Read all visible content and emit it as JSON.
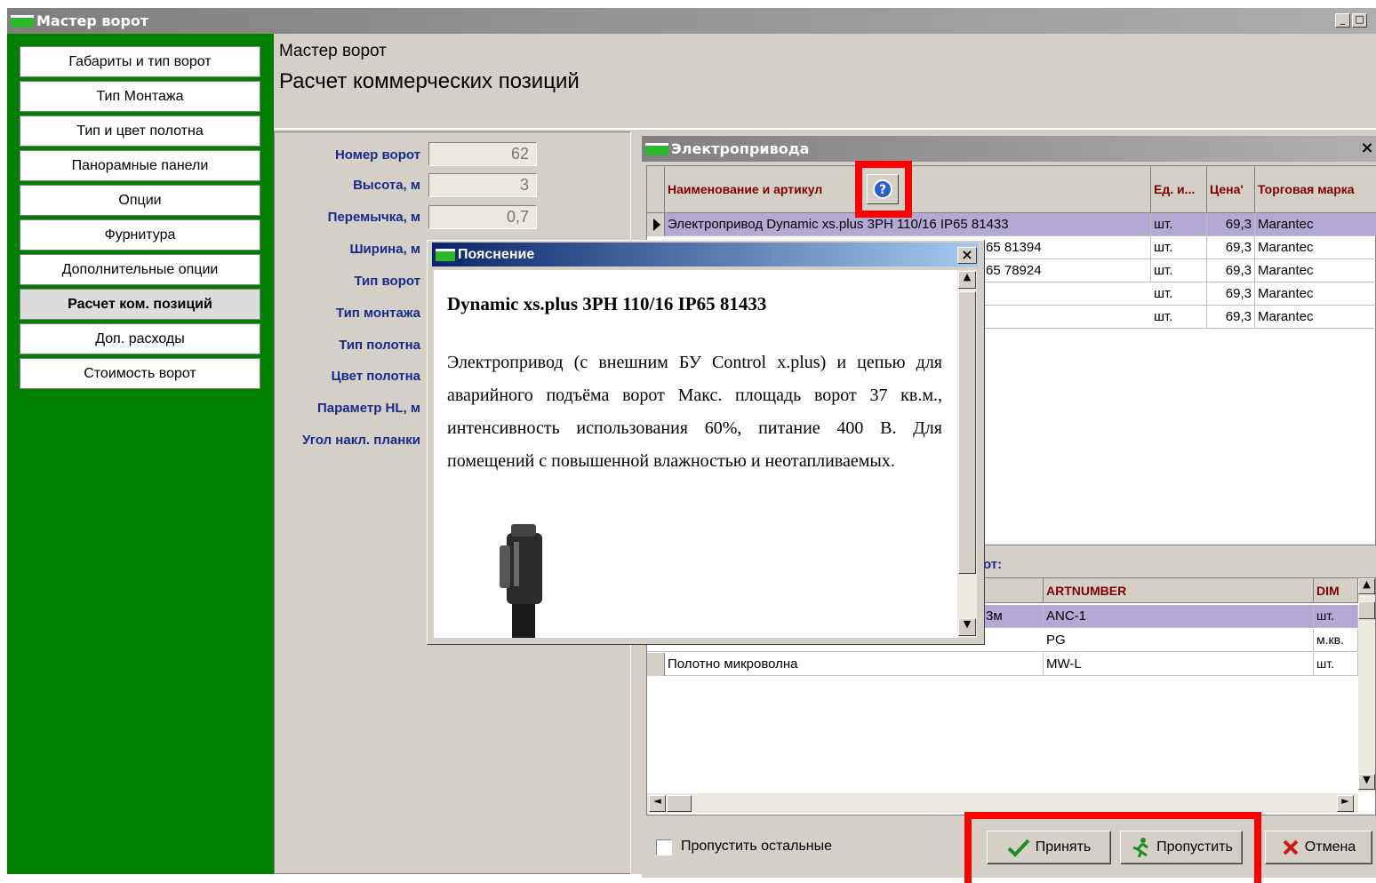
{
  "window": {
    "title": "Мастер ворот"
  },
  "sidebar": {
    "items": [
      "Габариты и тип ворот",
      "Тип Монтажа",
      "Тип и цвет полотна",
      "Панорамные панели",
      "Опции",
      "Фурнитура",
      "Дополнительные опции",
      "Расчет ком. позиций",
      "Доп. расходы",
      "Стоимость ворот"
    ],
    "active_index": 7
  },
  "header": {
    "subtitle": "Мастер ворот",
    "title": "Расчет коммерческих позиций"
  },
  "form": {
    "labels": {
      "gate_number": "Номер ворот",
      "height": "Высота, м",
      "lintel": "Перемычка, м",
      "width": "Ширина, м",
      "gate_type": "Тип ворот",
      "mount_type": "Тип монтажа",
      "panel_type": "Тип полотна",
      "panel_color": "Цвет полотна",
      "hl_param": "Параметр HL, м",
      "bar_angle": "Угол накл. планки"
    },
    "values": {
      "gate_number": "62",
      "height": "3",
      "lintel": "0,7"
    }
  },
  "drives_window": {
    "title": "Электропривода",
    "close": "×",
    "columns": {
      "name": "Наименование и артикул",
      "unit": "Ед. и...",
      "price": "Цена'",
      "brand": "Торговая марка"
    },
    "rows": [
      {
        "name": "Электропривод Dynamic xs.plus  3PH 110/16 IP65 81433",
        "unit": "шт.",
        "price": "69,3",
        "brand": "Marantec"
      },
      {
        "name": "65 81394",
        "unit": "шт.",
        "price": "69,3",
        "brand": "Marantec"
      },
      {
        "name": "65 78924",
        "unit": "шт.",
        "price": "69,3",
        "brand": "Marantec"
      },
      {
        "name": "",
        "unit": "шт.",
        "price": "69,3",
        "brand": "Marantec"
      },
      {
        "name": "",
        "unit": "шт.",
        "price": "69,3",
        "brand": "Marantec"
      }
    ],
    "section_label": "от:",
    "items_columns": {
      "artnumber": "ARTNUMBER",
      "dim": "DIM"
    },
    "items": [
      {
        "name": "3м",
        "artnumber": "ANC-1",
        "dim": "шт."
      },
      {
        "name": "",
        "artnumber": "PG",
        "dim": "м.кв."
      },
      {
        "name": "Полотно микроволна",
        "artnumber": "MW-L",
        "dim": "шт."
      }
    ],
    "skip_rest_label": "Пропустить остальные",
    "buttons": {
      "accept": "Принять",
      "skip": "Пропустить",
      "cancel": "Отмена"
    }
  },
  "popup": {
    "title": "Пояснение",
    "close": "×",
    "heading": "Dynamic xs.plus 3PH 110/16 IP65 81433",
    "text": "Электропривод (с внешним БУ Control x.plus) и цепью для аварийного подъёма ворот Макс. площадь ворот 37 кв.м., интенсивность использования 60%, питание 400 В. Для помещений с повышенной влажностью и неотапливаемых."
  },
  "colors": {
    "sidebar": "#008000",
    "highlight": "#ff0000",
    "selected_row": "#b4a8d4",
    "header_text": "#800000"
  }
}
